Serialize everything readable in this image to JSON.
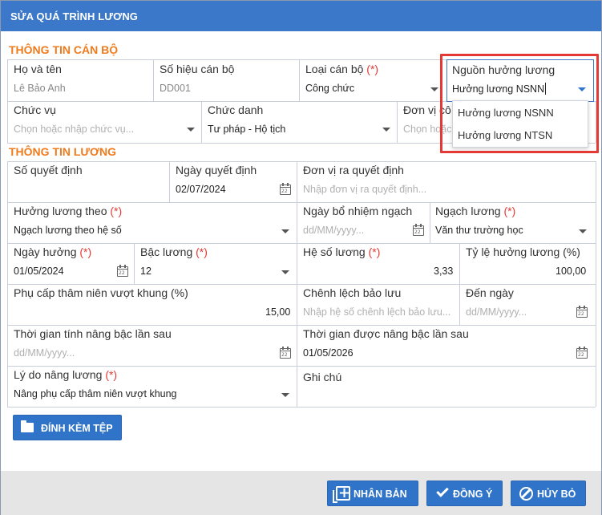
{
  "dialog": {
    "title": "SỬA QUÁ TRÌNH LƯƠNG"
  },
  "sections": {
    "staff": "THÔNG TIN CÁN BỘ",
    "salary": "THÔNG TIN LƯƠNG"
  },
  "staff": {
    "full_name": {
      "label": "Họ và tên",
      "value": "Lê Bảo Anh"
    },
    "staff_code": {
      "label": "Số hiệu cán bộ",
      "value": "DD001"
    },
    "staff_type": {
      "label": "Loại cán bộ",
      "required": "(*)",
      "value": "Công chức"
    },
    "salary_source": {
      "label": "Nguồn hưởng lương",
      "value": "Hưởng lương NSNN"
    },
    "position": {
      "label": "Chức vụ",
      "placeholder": "Chọn hoặc nhập chức vụ..."
    },
    "title": {
      "label": "Chức danh",
      "value": "Tư pháp - Hộ tịch"
    },
    "unit": {
      "label": "Đơn vị cô",
      "placeholder": "Chọn hoặc"
    }
  },
  "salary_source_options": [
    "Hưởng lương NSNN",
    "Hưởng lương NTSN"
  ],
  "salary": {
    "decision_no": {
      "label": "Số quyết định",
      "value": ""
    },
    "decision_date": {
      "label": "Ngày quyết định",
      "value": "02/07/2024"
    },
    "issuing_unit": {
      "label": "Đơn vị ra quyết định",
      "placeholder": "Nhập đơn vị ra quyết định..."
    },
    "salary_by": {
      "label": "Hưởng lương theo",
      "required": "(*)",
      "value": "Ngạch lương theo hệ số"
    },
    "rank_date": {
      "label": "Ngày bổ nhiệm ngạch",
      "placeholder": "dd/MM/yyyy..."
    },
    "rank": {
      "label": "Ngạch lương",
      "required": "(*)",
      "value": "Văn thư trường học"
    },
    "effective_date": {
      "label": "Ngày hưởng",
      "required": "(*)",
      "value": "01/05/2024"
    },
    "grade": {
      "label": "Bậc lương",
      "required": "(*)",
      "value": "12"
    },
    "coefficient": {
      "label": "Hệ số lương",
      "required": "(*)",
      "value": "3,33"
    },
    "rate": {
      "label": "Tỷ lệ hưởng lương (%)",
      "value": "100,00"
    },
    "seniority_allowance": {
      "label": "Phụ cấp thâm niên vượt khung (%)",
      "value": "15,00"
    },
    "reserve_diff": {
      "label": "Chênh lệch bảo lưu",
      "placeholder": "Nhập hệ số chênh lệch bảo lưu..."
    },
    "to_date": {
      "label": "Đến ngày",
      "placeholder": "dd/MM/yyyy..."
    },
    "next_raise_calc": {
      "label": "Thời gian tính nâng bậc lần sau",
      "placeholder": "dd/MM/yyyy..."
    },
    "next_raise": {
      "label": "Thời gian được nâng bậc lần sau",
      "value": "01/05/2026"
    },
    "reason": {
      "label": "Lý do nâng lương",
      "required": "(*)",
      "value": "Nâng phụ cấp thâm niên vượt khung"
    },
    "note": {
      "label": "Ghi chú",
      "value": ""
    }
  },
  "buttons": {
    "attach": "ĐÍNH KÈM TỆP",
    "duplicate": "NHÂN BẢN",
    "agree": "ĐỒNG Ý",
    "cancel": "HỦY BỎ"
  },
  "colors": {
    "header": "#3b78c9",
    "section": "#f07b1c",
    "required": "#e53935",
    "button": "#2f74c9"
  }
}
